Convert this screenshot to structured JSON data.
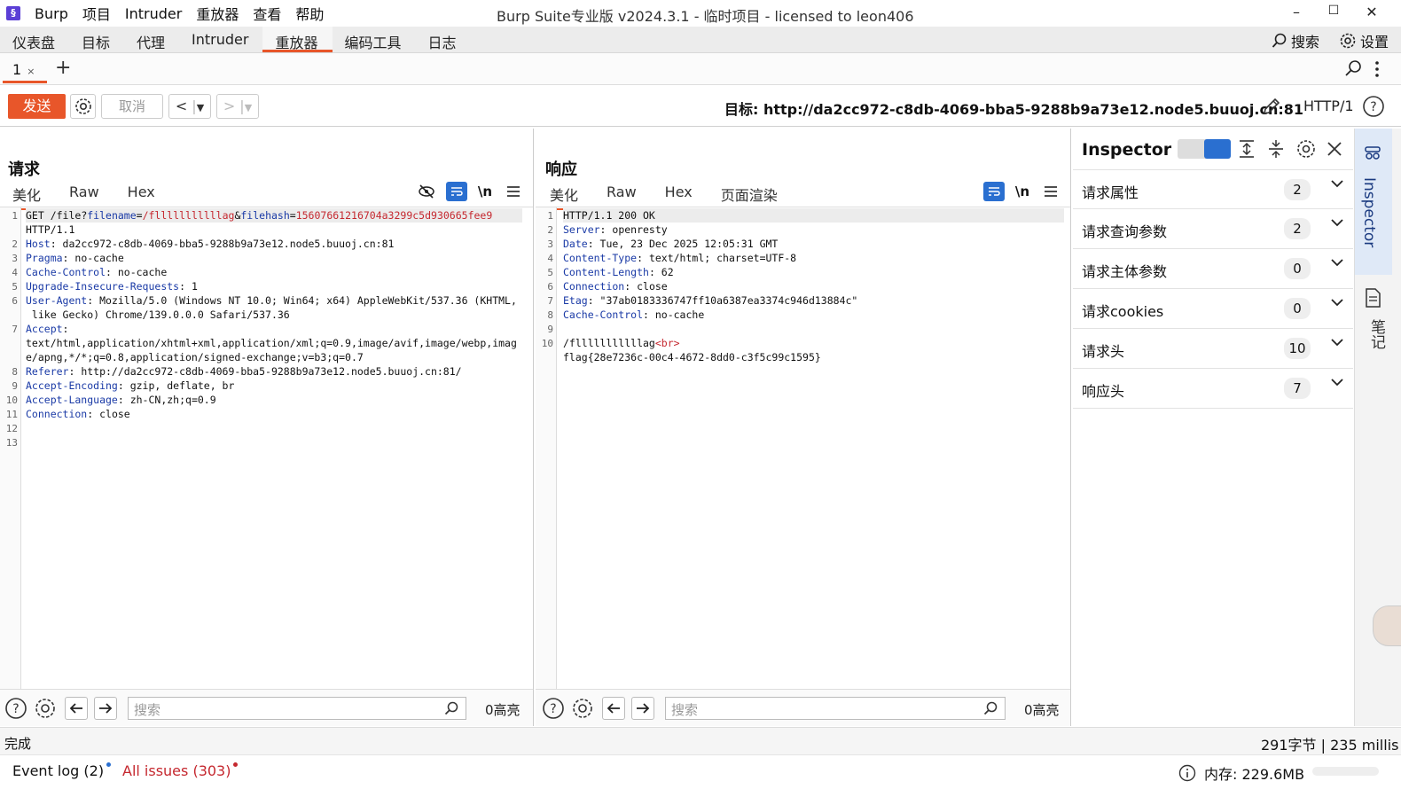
{
  "titlebar": {
    "app_icon": "§",
    "menu": [
      "Burp",
      "项目",
      "Intruder",
      "重放器",
      "查看",
      "帮助"
    ],
    "title": "Burp Suite专业版  v2024.3.1 - 临时项目 - licensed to leon406",
    "minimize": "–",
    "maximize": "☐",
    "close": "✕"
  },
  "main_tabs": [
    "仪表盘",
    "目标",
    "代理",
    "Intruder",
    "重放器",
    "编码工具",
    "日志"
  ],
  "main_tabs_active": "重放器",
  "top_right": {
    "search_label": "搜索",
    "settings_label": "设置"
  },
  "sub_tabs": [
    {
      "label": "1",
      "close": "×"
    }
  ],
  "add_tab": "+",
  "toolbar": {
    "send_label": "发送",
    "cancel_label": "取消",
    "target_label": "目标: http://da2cc972-c8db-4069-bba5-9288b9a73e12.node5.buuoj.cn:81",
    "http_version": "HTTP/1"
  },
  "request": {
    "title": "请求",
    "tabs": [
      "美化",
      "Raw",
      "Hex"
    ],
    "active_tab": "美化",
    "newline_icon": "\\n",
    "line_numbers": [
      "1",
      "",
      "2",
      "3",
      "4",
      "5",
      "6",
      "",
      "7",
      "",
      "",
      "8",
      "9",
      "10",
      "11",
      "12",
      "13"
    ],
    "lines": {
      "l1_method": "GET ",
      "l1_path": "/file?",
      "l1_p1": "filename",
      "l1_eq1": "=",
      "l1_v1": "/flllllllllllag",
      "l1_amp": "&",
      "l1_p2": "filehash",
      "l1_eq2": "=",
      "l1_v2": "15607661216704a3299c5d930665fee9",
      "l1b": "HTTP/1.1",
      "l2_k": "Host",
      "l2_v": ": da2cc972-c8db-4069-bba5-9288b9a73e12.node5.buuoj.cn:81",
      "l3_k": "Pragma",
      "l3_v": ": no-cache",
      "l4_k": "Cache-Control",
      "l4_v": ": no-cache",
      "l5_k": "Upgrade-Insecure-Requests",
      "l5_v": ": 1",
      "l6_k": "User-Agent",
      "l6_v": ": Mozilla/5.0 (Windows NT 10.0; Win64; x64) AppleWebKit/537.36 (KHTML,",
      "l6b": " like Gecko) Chrome/139.0.0.0 Safari/537.36",
      "l7_k": "Accept",
      "l7_v": ":",
      "l7b": "text/html,application/xhtml+xml,application/xml;q=0.9,image/avif,image/webp,imag",
      "l7c": "e/apng,*/*;q=0.8,application/signed-exchange;v=b3;q=0.7",
      "l8_k": "Referer",
      "l8_v": ": http://da2cc972-c8db-4069-bba5-9288b9a73e12.node5.buuoj.cn:81/",
      "l9_k": "Accept-Encoding",
      "l9_v": ": gzip, deflate, br",
      "l10_k": "Accept-Language",
      "l10_v": ": zh-CN,zh;q=0.9",
      "l11_k": "Connection",
      "l11_v": ": close"
    },
    "search_placeholder": "搜索",
    "highlights": "0高亮"
  },
  "response": {
    "title": "响应",
    "tabs": [
      "美化",
      "Raw",
      "Hex",
      "页面渲染"
    ],
    "active_tab": "美化",
    "newline_icon": "\\n",
    "line_numbers": [
      "1",
      "2",
      "3",
      "4",
      "5",
      "6",
      "7",
      "8",
      "9",
      "10"
    ],
    "lines": {
      "l1": "HTTP/1.1 200 OK",
      "l2_k": "Server",
      "l2_v": ": openresty",
      "l3_k": "Date",
      "l3_v": ": Tue, 23 Dec 2025 12:05:31 GMT",
      "l4_k": "Content-Type",
      "l4_v": ": text/html; charset=UTF-8",
      "l5_k": "Content-Length",
      "l5_v": ": 62",
      "l6_k": "Connection",
      "l6_v": ": close",
      "l7_k": "Etag",
      "l7_v": ": \"37ab0183336747ff10a6387ea3374c946d13884c\"",
      "l8_k": "Cache-Control",
      "l8_v": ": no-cache",
      "l10_a": "/flllllllllllag",
      "l10_tag": "<br>",
      "l10b": "flag{28e7236c-00c4-4672-8dd0-c3f5c99c1595}"
    },
    "search_placeholder": "搜索",
    "highlights": "0高亮"
  },
  "inspector": {
    "title": "Inspector",
    "rows": [
      {
        "label": "请求属性",
        "count": "2"
      },
      {
        "label": "请求查询参数",
        "count": "2"
      },
      {
        "label": "请求主体参数",
        "count": "0"
      },
      {
        "label": "请求cookies",
        "count": "0"
      },
      {
        "label": "请求头",
        "count": "10"
      },
      {
        "label": "响应头",
        "count": "7"
      }
    ],
    "side_label": "Inspector",
    "notes_label": "笔记"
  },
  "status": {
    "left": "完成",
    "right": "291字节 | 235 millis"
  },
  "bottom": {
    "event_log": "Event log (2)",
    "all_issues": "All issues (303)",
    "memory": "内存: 229.6MB"
  },
  "colors": {
    "accent": "#e8562a",
    "blue": "#2a6fd0",
    "key": "#1a3aa6",
    "red": "#c5282f"
  }
}
